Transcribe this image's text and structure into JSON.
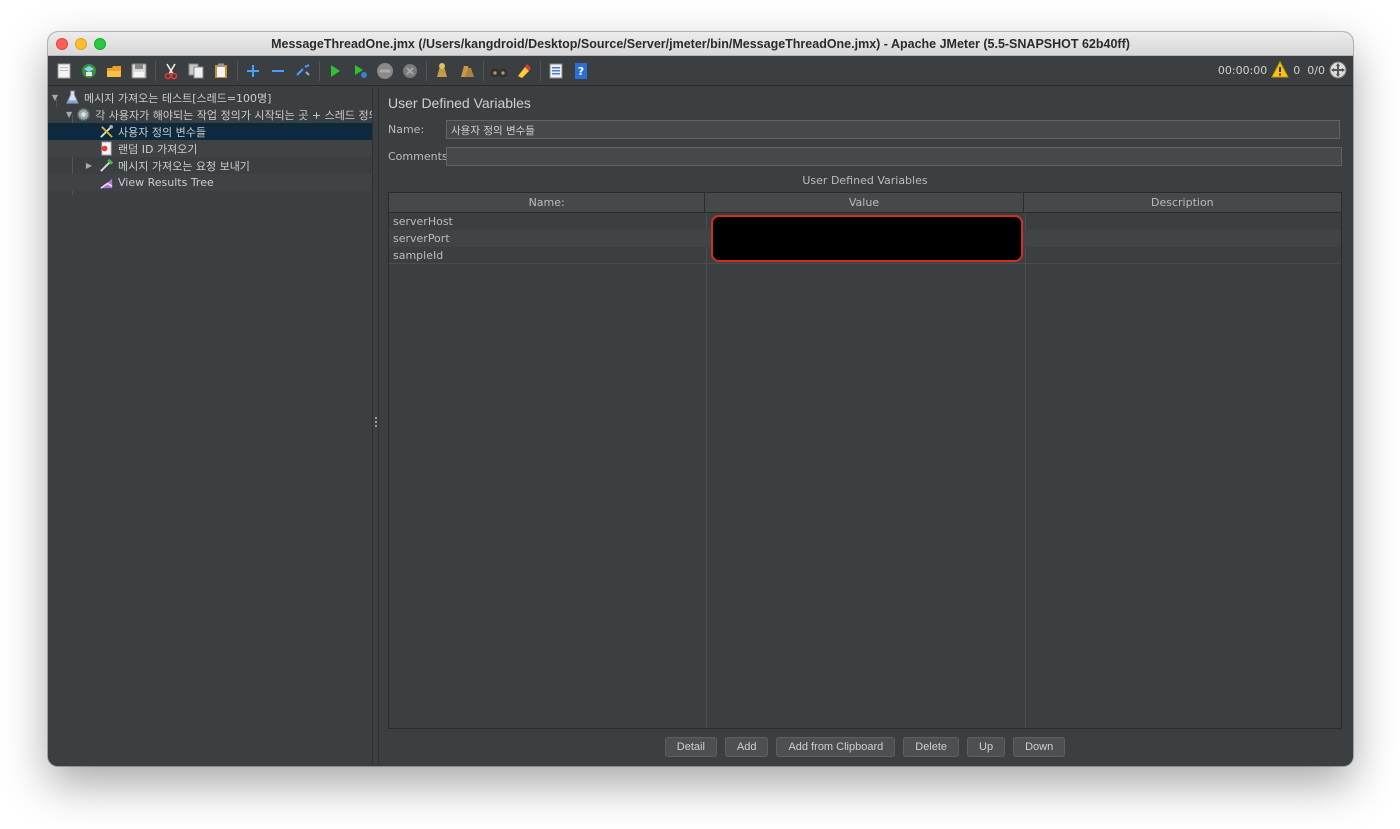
{
  "window": {
    "title": "MessageThreadOne.jmx (/Users/kangdroid/Desktop/Source/Server/jmeter/bin/MessageThreadOne.jmx) - Apache JMeter (5.5-SNAPSHOT 62b40ff)"
  },
  "toolbar": {
    "icons": [
      "new-icon",
      "templates-icon",
      "open-icon",
      "save-icon",
      "cut-icon",
      "copy-icon",
      "paste-icon",
      "expand-icon",
      "collapse-icon",
      "toggle-icon",
      "start-icon",
      "start-no-pause-icon",
      "stop-icon",
      "shutdown-icon",
      "clear-icon",
      "clear-all-icon",
      "search-icon",
      "reset-search-icon",
      "function-helper-icon",
      "help-icon"
    ],
    "timer": "00:00:00",
    "warning_count": "0",
    "threads": "0/0"
  },
  "tree": {
    "items": [
      {
        "label": "메시지 가져오는 테스트[스레드=100명]",
        "icon": "test-plan-icon"
      },
      {
        "label": "각 사용자가 해야되는 작업 정의가 시작되는 곳 + 스레드 정의",
        "icon": "thread-group-icon"
      },
      {
        "label": "사용자 정의 변수들",
        "icon": "config-element-icon"
      },
      {
        "label": "랜덤 ID 가져오기",
        "icon": "csv-data-icon"
      },
      {
        "label": "메시지 가져오는 요청 보내기",
        "icon": "sampler-icon"
      },
      {
        "label": "View Results Tree",
        "icon": "listener-icon"
      }
    ]
  },
  "panel": {
    "title": "User Defined Variables",
    "name_label": "Name:",
    "name_value": "사용자 정의 변수들",
    "comments_label": "Comments:",
    "comments_value": "",
    "group_title": "User Defined Variables",
    "columns": [
      "Name:",
      "Value",
      "Description"
    ],
    "rows": [
      {
        "name": "serverHost",
        "value": "",
        "description": ""
      },
      {
        "name": "serverPort",
        "value": "",
        "description": ""
      },
      {
        "name": "sampleId",
        "value": "",
        "description": ""
      }
    ],
    "buttons": [
      "Detail",
      "Add",
      "Add from Clipboard",
      "Delete",
      "Up",
      "Down"
    ]
  },
  "colors": {
    "background": "#3c3f41",
    "selection": "#0d293e",
    "redaction_border": "#d32f21"
  }
}
